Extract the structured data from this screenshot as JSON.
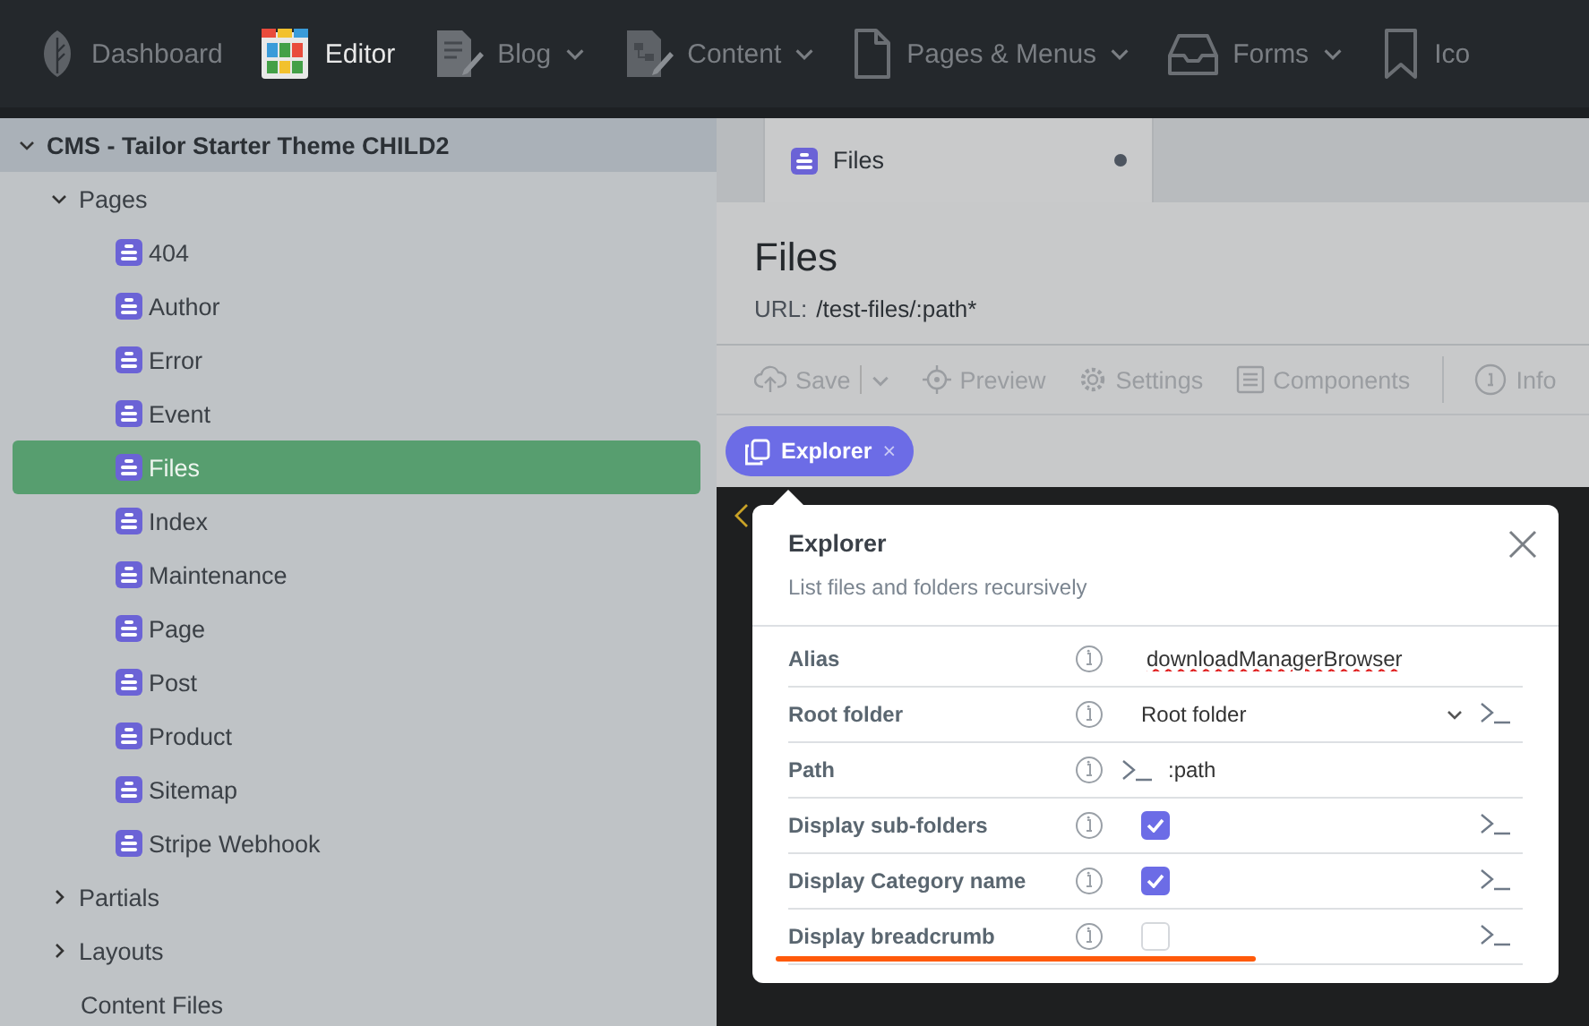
{
  "top_nav": {
    "items": [
      {
        "label": "Dashboard",
        "dropdown": false,
        "selected": false
      },
      {
        "label": "Editor",
        "dropdown": false,
        "selected": true
      },
      {
        "label": "Blog",
        "dropdown": true,
        "selected": false
      },
      {
        "label": "Content",
        "dropdown": true,
        "selected": false
      },
      {
        "label": "Pages & Menus",
        "dropdown": true,
        "selected": false
      },
      {
        "label": "Forms",
        "dropdown": true,
        "selected": false
      },
      {
        "label": "Ico",
        "dropdown": false,
        "selected": false
      }
    ]
  },
  "sidebar": {
    "root": {
      "label": "CMS - Tailor Starter Theme CHILD2",
      "expanded": true
    },
    "items": [
      {
        "kind": "folder",
        "label": "Pages",
        "expanded": true,
        "children": [
          {
            "kind": "page",
            "label": "404",
            "selected": false
          },
          {
            "kind": "page",
            "label": "Author",
            "selected": false
          },
          {
            "kind": "page",
            "label": "Error",
            "selected": false
          },
          {
            "kind": "page",
            "label": "Event",
            "selected": false
          },
          {
            "kind": "page",
            "label": "Files",
            "selected": true
          },
          {
            "kind": "page",
            "label": "Index",
            "selected": false
          },
          {
            "kind": "page",
            "label": "Maintenance",
            "selected": false
          },
          {
            "kind": "page",
            "label": "Page",
            "selected": false
          },
          {
            "kind": "page",
            "label": "Post",
            "selected": false
          },
          {
            "kind": "page",
            "label": "Product",
            "selected": false
          },
          {
            "kind": "page",
            "label": "Sitemap",
            "selected": false
          },
          {
            "kind": "page",
            "label": "Stripe Webhook",
            "selected": false
          }
        ]
      },
      {
        "kind": "folder",
        "label": "Partials",
        "expanded": false
      },
      {
        "kind": "folder",
        "label": "Layouts",
        "expanded": false
      },
      {
        "kind": "label",
        "label": "Content Files"
      }
    ]
  },
  "editor": {
    "tab": {
      "label": "Files",
      "modified": true
    },
    "title": "Files",
    "url_label": "URL:",
    "url": "/test-files/:path*",
    "toolbar": [
      {
        "label": "Save",
        "split": true
      },
      {
        "label": "Preview",
        "split": false
      },
      {
        "label": "Settings",
        "split": false
      },
      {
        "label": "Components",
        "split": false
      },
      {
        "label": "Info",
        "split": false
      }
    ],
    "component_chip": {
      "label": "Explorer",
      "close": "×"
    }
  },
  "popover": {
    "title": "Explorer",
    "description": "List files and folders recursively",
    "fields": [
      {
        "kind": "text",
        "label": "Alias",
        "value": "downloadManagerBrowser",
        "code_toggle": false
      },
      {
        "kind": "dropdown",
        "label": "Root folder",
        "value": "Root folder",
        "code_toggle": true
      },
      {
        "kind": "code",
        "label": "Path",
        "value": ":path",
        "code_toggle": false
      },
      {
        "kind": "checkbox",
        "label": "Display sub-folders",
        "checked": true,
        "code_toggle": true
      },
      {
        "kind": "checkbox",
        "label": "Display Category name",
        "checked": true,
        "code_toggle": true
      },
      {
        "kind": "checkbox",
        "label": "Display breadcrumb",
        "checked": false,
        "code_toggle": true
      }
    ]
  }
}
